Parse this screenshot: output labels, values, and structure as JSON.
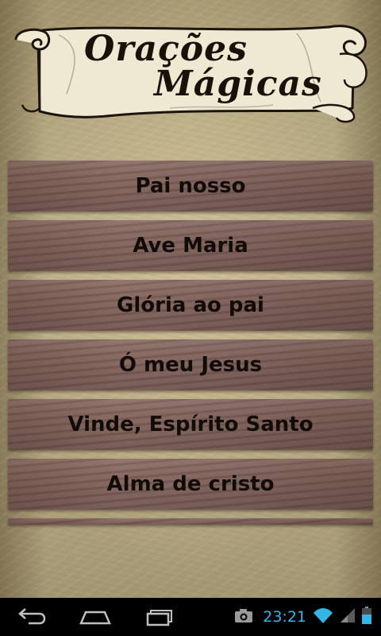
{
  "banner": {
    "title_line1": "Orações",
    "title_line2": "Mágicas"
  },
  "menu": {
    "items": [
      {
        "label": "Pai nosso"
      },
      {
        "label": "Ave Maria"
      },
      {
        "label": "Glória ao pai"
      },
      {
        "label": "Ó meu Jesus"
      },
      {
        "label": "Vinde, Espírito Santo"
      },
      {
        "label": "Alma de cristo"
      }
    ]
  },
  "navbar": {
    "buttons": [
      "back-icon",
      "home-icon",
      "recent-apps-icon"
    ]
  },
  "status": {
    "time": "23:21",
    "icons": [
      "camera-icon",
      "wifi-icon",
      "signal-icon",
      "battery-icon"
    ],
    "accent_color": "#33b5e5"
  },
  "colors": {
    "background": "#b3a780",
    "menu_item": "#846760",
    "text": "#120c08"
  }
}
